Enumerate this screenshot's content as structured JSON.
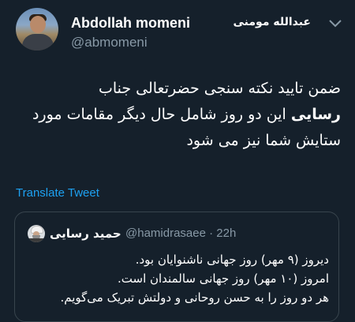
{
  "author": {
    "display_name": "Abdollah momeni",
    "display_name_fa": "عبدالله مومنی",
    "handle": "@abmomeni"
  },
  "tweet": {
    "text_part1": "ضمن تایید نکته سنجی حضرتعالی جناب",
    "text_bold": "رسایی",
    "text_part2": " این دو روز شامل حال دیگر مقامات مورد ستایش شما نیز می شود"
  },
  "translate_label": "Translate Tweet",
  "quoted": {
    "name": "حمید رسایی",
    "handle": "@hamidrasaee",
    "separator": " · ",
    "time": "22h",
    "lines": [
      "دیروز (۹ مهر) روز جهانی ناشنوایان بود.",
      "امروز (۱۰ مهر) روز جهانی سالمندان است.",
      "هر دو روز را به حسن روحانی و دولتش تبریک می‌گویم."
    ]
  },
  "icons": {
    "menu": "chevron-down-icon",
    "avatar": "profile-photo",
    "quoted_avatar": "profile-photo"
  },
  "colors": {
    "background": "#15202b",
    "secondary_text": "#8899a6",
    "link": "#1da1f2",
    "border": "#38444d"
  }
}
